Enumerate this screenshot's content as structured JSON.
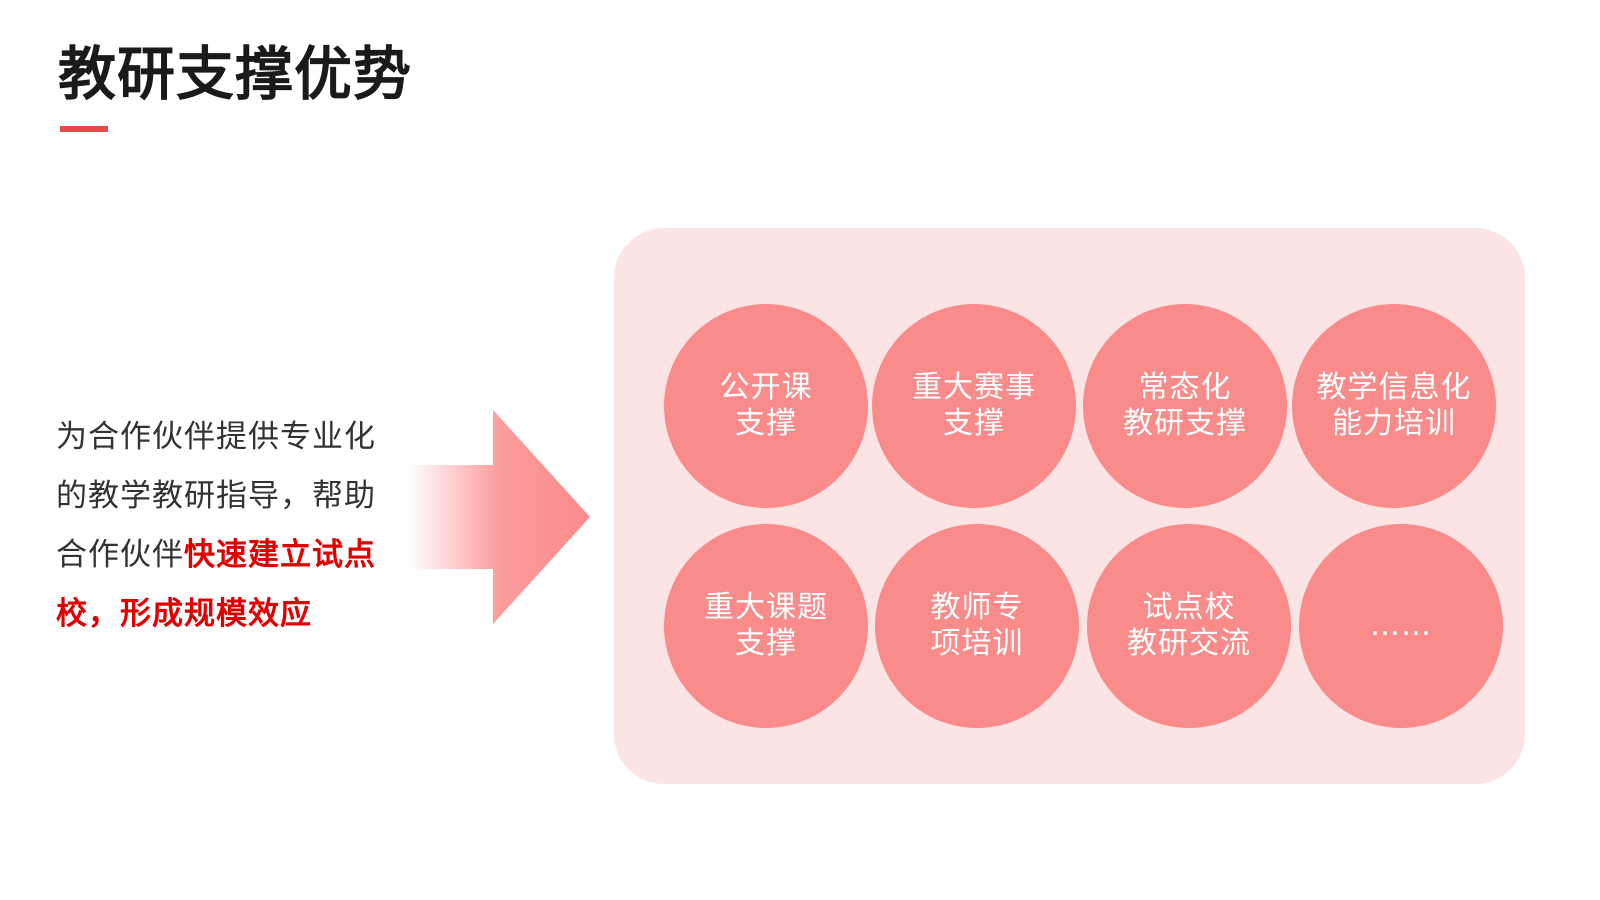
{
  "title": "教研支撑优势",
  "description": {
    "normal": "为合作伙伴提供专业化的教学教研指导，帮助合作伙伴",
    "highlight": "快速建立试点校，形成规模效应"
  },
  "items": [
    {
      "label": "公开课\n支撑"
    },
    {
      "label": "重大赛事\n支撑"
    },
    {
      "label": "常态化\n教研支撑"
    },
    {
      "label": "教学信息化\n能力培训"
    },
    {
      "label": "重大课题\n支撑"
    },
    {
      "label": "教师专\n项培训"
    },
    {
      "label": "试点校\n教研交流"
    },
    {
      "label": "……"
    }
  ],
  "colors": {
    "accent": "#e8474c",
    "highlight_text": "#e00000",
    "panel_bg": "#fde4e4",
    "circle_fill": "#fa8b8b",
    "arrow": "#fa8b8b"
  }
}
